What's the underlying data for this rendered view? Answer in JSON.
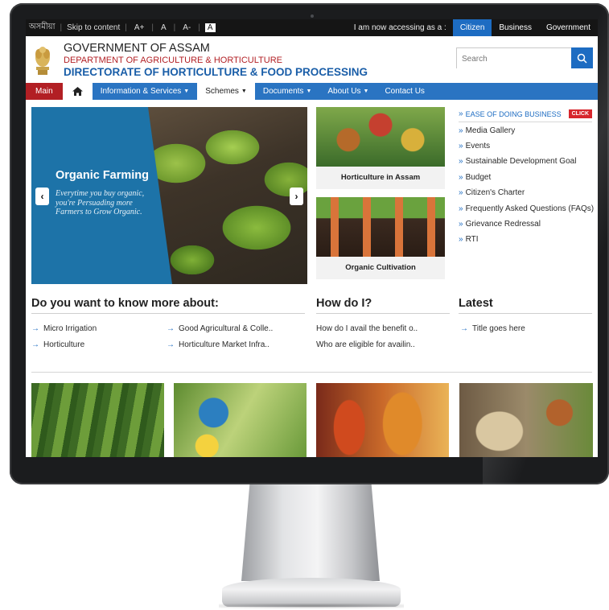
{
  "topbar": {
    "lang": "অসমীয়া",
    "skip": "Skip to content",
    "font_sizes": [
      "A+",
      "A",
      "A-",
      "A"
    ],
    "accessing": "I am now accessing as a :",
    "roles": [
      "Citizen",
      "Business",
      "Government"
    ]
  },
  "header": {
    "line1": "GOVERNMENT OF ASSAM",
    "line2": "DEPARTMENT OF AGRICULTURE & HORTICULTURE",
    "line3": "DIRECTORATE OF HORTICULTURE & FOOD PROCESSING",
    "search_placeholder": "Search"
  },
  "nav": {
    "main": "Main",
    "items": [
      "Information & Services",
      "Schemes",
      "Documents",
      "About Us",
      "Contact Us"
    ]
  },
  "hero": {
    "title": "Organic Farming",
    "subtitle": "Everytime you buy organic, you're Persuading more Farmers to Grow Organic."
  },
  "tiles": [
    "Horticulture in Assam",
    "Organic Cultivation"
  ],
  "side_links": {
    "ease": "EASE OF DOING BUSINESS",
    "click": "CLICK",
    "items": [
      "Media Gallery",
      "Events",
      "Sustainable Development Goal",
      "Budget",
      "Citizen's Charter",
      "Frequently Asked Questions (FAQs)",
      "Grievance Redressal",
      "RTI"
    ]
  },
  "know_more": {
    "heading": "Do you want to know more about:",
    "items": [
      "Micro Irrigation",
      "Good Agricultural & Colle..",
      "Horticulture",
      "Horticulture Market Infra.."
    ]
  },
  "how_do_i": {
    "heading": "How do I?",
    "items": [
      "How do I avail the benefit o..",
      "Who are eligible for availin.."
    ]
  },
  "latest": {
    "heading": "Latest",
    "items": [
      "Title goes here"
    ]
  },
  "colors": {
    "nav_blue": "#2a74c2",
    "main_red": "#b21f24",
    "accent_blue": "#1d6cc2",
    "hero_panel": "#1d73a8"
  }
}
